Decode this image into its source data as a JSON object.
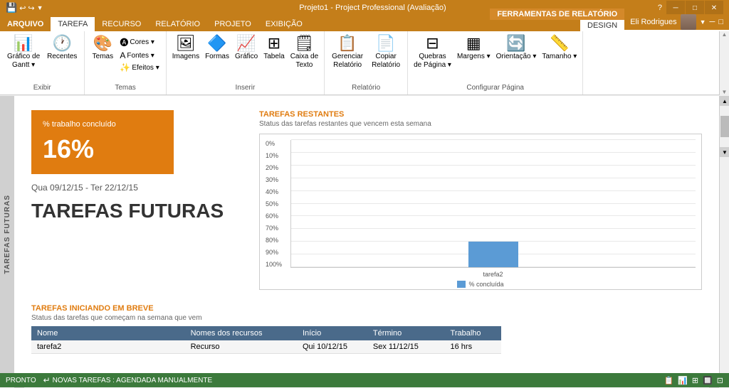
{
  "titlebar": {
    "title": "Projeto1 - Project Professional (Avaliação)",
    "tools_label": "FERRAMENTAS DE RELATÓRIO"
  },
  "ribbon": {
    "tabs": [
      {
        "label": "ARQUIVO",
        "active": false
      },
      {
        "label": "TAREFA",
        "active": false
      },
      {
        "label": "RECURSO",
        "active": false
      },
      {
        "label": "RELATÓRIO",
        "active": false
      },
      {
        "label": "PROJETO",
        "active": false
      },
      {
        "label": "EXIBIÇÃO",
        "active": false
      }
    ],
    "tools_tab": "FERRAMENTAS DE RELATÓRIO",
    "design_tab": "DESIGN",
    "groups": [
      {
        "label": "Exibir",
        "buttons": [
          {
            "label": "Gráfico de\nGantt",
            "icon": "📊"
          },
          {
            "label": "Recentes",
            "icon": "🕐"
          }
        ]
      },
      {
        "label": "Temas",
        "buttons": [
          {
            "label": "Temas",
            "icon": "🎨"
          },
          {
            "sub": [
              "Cores",
              "Fontes",
              "Efeitos"
            ]
          }
        ]
      },
      {
        "label": "Inserir",
        "buttons": [
          {
            "label": "Imagens",
            "icon": "🖼"
          },
          {
            "label": "Formas",
            "icon": "🔷"
          },
          {
            "label": "Gráfico",
            "icon": "📈"
          },
          {
            "label": "Tabela",
            "icon": "⊞"
          },
          {
            "label": "Caixa de\nTexto",
            "icon": "🗒"
          }
        ]
      },
      {
        "label": "Relatório",
        "buttons": [
          {
            "label": "Gerenciar\nRelatório",
            "icon": "📋"
          },
          {
            "label": "Copiar\nRelatório",
            "icon": "📄"
          }
        ]
      },
      {
        "label": "Configurar Página",
        "buttons": [
          {
            "label": "Quebras\nde Página",
            "icon": "⊟"
          },
          {
            "label": "Margens",
            "icon": "▦"
          },
          {
            "label": "Orientação",
            "icon": "🔄"
          },
          {
            "label": "Tamanho",
            "icon": "📏"
          }
        ]
      }
    ]
  },
  "user": {
    "name": "Eli Rodrigues"
  },
  "sidebar": {
    "label": "TAREFAS FUTURAS"
  },
  "report": {
    "progress": {
      "label": "% trabalho concluído",
      "value": "16%"
    },
    "date_range": "Qua 09/12/15 -  Ter 22/12/15",
    "title": "TAREFAS FUTURAS",
    "chart": {
      "section_title": "TAREFAS RESTANTES",
      "subtitle": "Status das tarefas restantes que vencem esta semana",
      "y_labels": [
        "100%",
        "90%",
        "80%",
        "70%",
        "60%",
        "50%",
        "40%",
        "30%",
        "20%",
        "10%",
        "0%"
      ],
      "bars": [
        {
          "label": "tarefa2",
          "value": 20,
          "height_pct": 20
        }
      ],
      "legend_label": "% concluída",
      "legend_color": "#5b9bd5"
    },
    "bottom": {
      "section_title": "TAREFAS INICIANDO EM BREVE",
      "subtitle": "Status das tarefas que começam na semana que vem",
      "table": {
        "headers": [
          "Nome",
          "Nomes dos recursos",
          "Início",
          "Término",
          "Trabalho"
        ],
        "rows": [
          [
            "tarefa2",
            "Recurso",
            "Qui 10/12/15",
            "Sex 11/12/15",
            "16 hrs"
          ]
        ]
      }
    }
  },
  "status_bar": {
    "status": "PRONTO",
    "notice_icon": "↵",
    "notice_text": "NOVAS TAREFAS : AGENDADA MANUALMENTE"
  },
  "window_controls": {
    "minimize": "─",
    "maximize": "□",
    "close": "✕",
    "help": "?"
  }
}
